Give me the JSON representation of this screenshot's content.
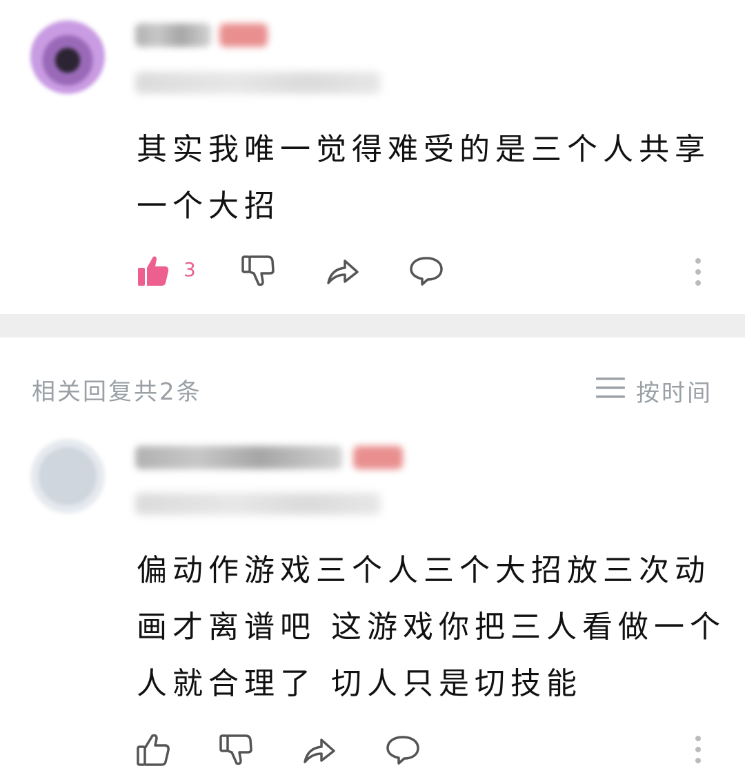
{
  "main_comment": {
    "text_lines": [
      "其实我唯一觉得难受的是三个人共享",
      "一个大招"
    ],
    "like_count": "3",
    "like_color": "#ec5f8f"
  },
  "replies": {
    "header": "相关回复共2条",
    "sort_label": "按时间",
    "items": [
      {
        "text_lines": [
          "偏动作游戏三个人三个大招放三次动",
          "画才离谱吧 这游戏你把三人看做一个",
          "人就合理了 切人只是切技能"
        ]
      }
    ]
  },
  "icons": {
    "like": "thumbs-up-icon",
    "dislike": "thumbs-down-icon",
    "share": "share-arrow-icon",
    "comment": "comment-bubble-icon",
    "more": "more-vertical-icon",
    "sort": "sort-lines-icon"
  },
  "colors": {
    "accent_like": "#ec5f8f",
    "muted_text": "#9aa0a6",
    "divider": "#eeeeef"
  }
}
